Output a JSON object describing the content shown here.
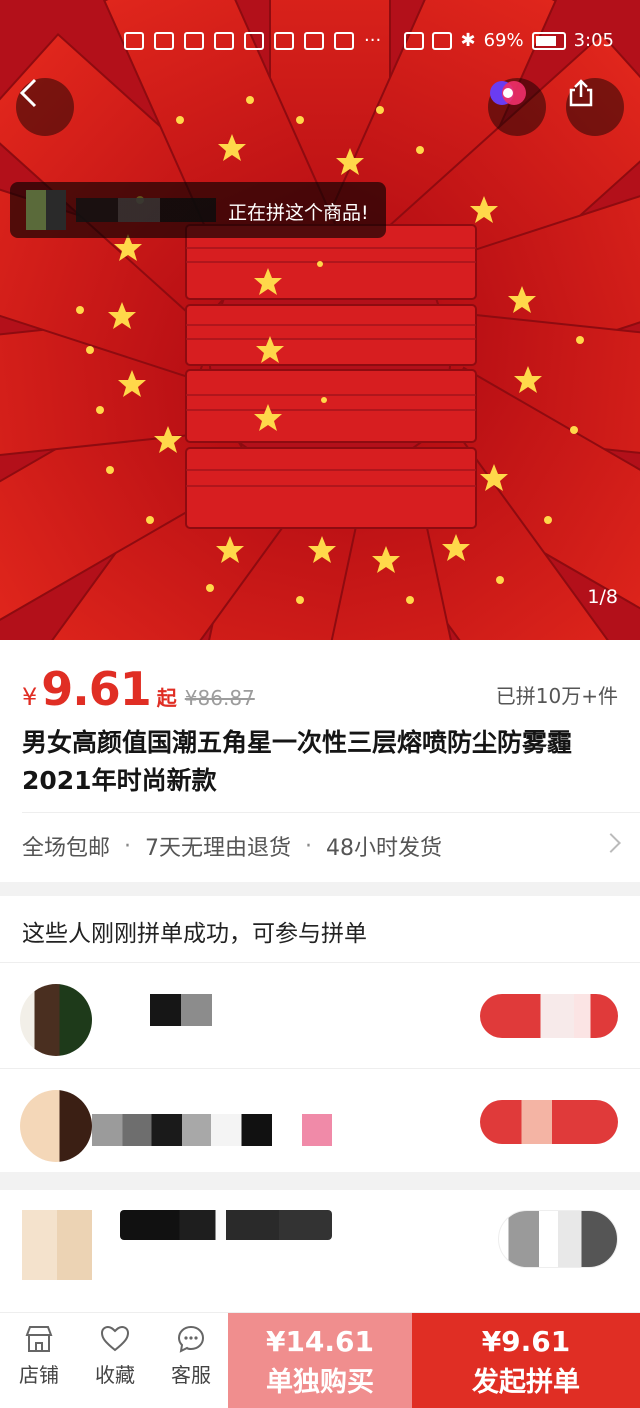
{
  "status_bar": {
    "left_icons": [
      "hd-icon",
      "5g-signal-icon",
      "wifi-icon",
      "wechat-icon",
      "app-icon",
      "health-app-icon",
      "app-icon",
      "app-icon",
      "more-icon"
    ],
    "battery": "69%",
    "time": "3:05"
  },
  "hero": {
    "notice_text": "正在拼这个商品!",
    "page_indicator": "1/8",
    "colors": {
      "red": "#c8141a",
      "star": "#ffd84a"
    }
  },
  "product": {
    "currency": "¥",
    "price": "9.61",
    "price_suffix": "起",
    "original_price": "¥86.87",
    "sold": "已拼10万+件",
    "title": "男女高颜值国潮五角星一次性三层熔喷防尘防雾霾2021年时尚新款",
    "services": [
      "全场包邮",
      "7天无理由退货",
      "48小时发货"
    ],
    "service_separator": "·"
  },
  "group": {
    "heading": "这些人刚刚拼单成功，可参与拼单"
  },
  "bottom_bar": {
    "tabs": [
      {
        "label": "店铺",
        "icon": "store-icon"
      },
      {
        "label": "收藏",
        "icon": "heart-icon"
      },
      {
        "label": "客服",
        "icon": "chat-icon"
      }
    ],
    "solo_price": "¥14.61",
    "solo_label": "单独购买",
    "group_price": "¥9.61",
    "group_label": "发起拼单",
    "accent": "#e02e24"
  }
}
